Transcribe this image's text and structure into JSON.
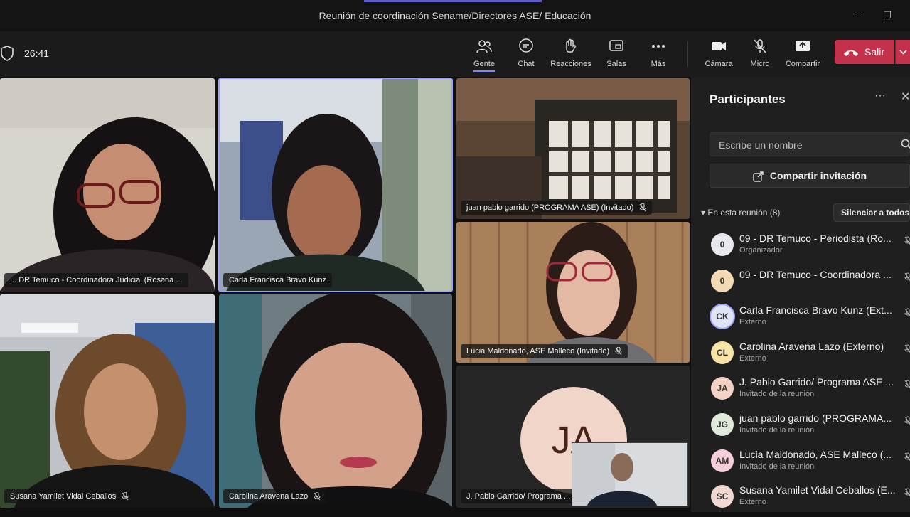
{
  "window": {
    "title": "Reunión de coordinación Sename/Directores ASE/ Educación",
    "minimize": "—",
    "maximize": "☐"
  },
  "toolbar": {
    "timer": "26:41",
    "items": [
      {
        "label": "Gente",
        "icon": "people-icon",
        "active": true
      },
      {
        "label": "Chat",
        "icon": "chat-icon"
      },
      {
        "label": "Reacciones",
        "icon": "reactions-icon"
      },
      {
        "label": "Salas",
        "icon": "rooms-icon"
      },
      {
        "label": "Más",
        "icon": "more-icon"
      },
      {
        "label": "Cámara",
        "icon": "camera-icon"
      },
      {
        "label": "Micro",
        "icon": "mic-off-icon"
      },
      {
        "label": "Compartir",
        "icon": "share-icon"
      }
    ],
    "leave_label": "Salir",
    "leave_color": "#c4314b"
  },
  "tiles": [
    {
      "name": "... DR Temuco - Coordinadora Judicial (Rosana ..."
    },
    {
      "name": "Carla Francisca Bravo Kunz"
    },
    {
      "name": "juan pablo garrido (PROGRAMA ASE) (Invitado)"
    },
    {
      "name": "Lucia Maldonado, ASE Malleco (Invitado)"
    },
    {
      "name": "Susana Yamilet Vidal Ceballos"
    },
    {
      "name": "Carolina Aravena Lazo"
    },
    {
      "name": "J. Pablo Garrido/ Programa ...",
      "initials": "JA"
    }
  ],
  "panel": {
    "title": "Participantes",
    "search_placeholder": "Escribe un nombre",
    "share_invite": "Compartir invitación",
    "section": "En esta reunión (8)",
    "mute_all": "Silenciar a todos",
    "participants": [
      {
        "initials": "0",
        "name": "09 - DR Temuco - Periodista (Ro...",
        "role": "Organizador",
        "color": "#e8e8ef"
      },
      {
        "initials": "0",
        "name": "09 - DR Temuco - Coordinadora ...",
        "role": "",
        "color": "#f4d9b5"
      },
      {
        "initials": "CK",
        "name": "Carla Francisca Bravo Kunz (Ext...",
        "role": "Externo",
        "color": "#dfe3f6"
      },
      {
        "initials": "CL",
        "name": "Carolina Aravena Lazo (Externo)",
        "role": "Externo",
        "color": "#f7e4a6"
      },
      {
        "initials": "JA",
        "name": "J. Pablo Garrido/ Programa ASE ...",
        "role": "Invitado de la reunión",
        "color": "#f4d2c6"
      },
      {
        "initials": "JG",
        "name": "juan pablo garrido (PROGRAMA...",
        "role": "Invitado de la reunión",
        "color": "#dfe9dc"
      },
      {
        "initials": "AM",
        "name": "Lucia Maldonado, ASE Malleco (...",
        "role": "Invitado de la reunión",
        "color": "#f4cfd9"
      },
      {
        "initials": "SC",
        "name": "Susana Yamilet Vidal Ceballos (E...",
        "role": "Externo",
        "color": "#f2d8d2"
      }
    ]
  }
}
